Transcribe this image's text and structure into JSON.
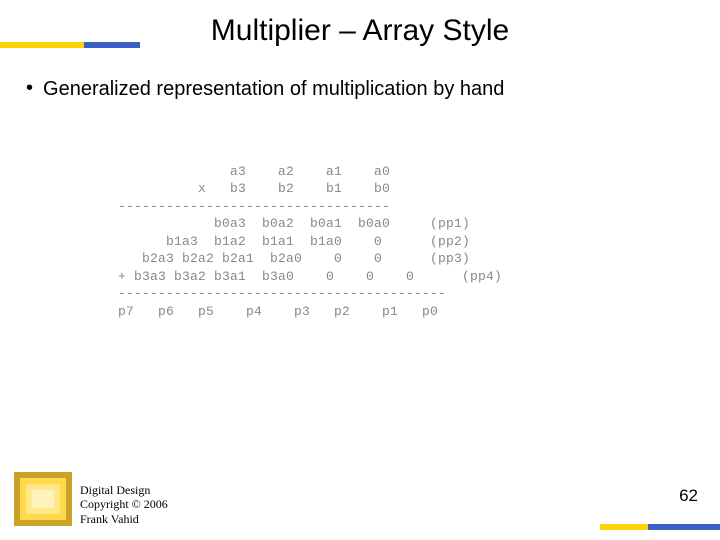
{
  "title": "Multiplier – Array Style",
  "bullet": "Generalized representation of multiplication by hand",
  "diagram": {
    "r1": "              a3    a2    a1    a0",
    "r2": "          x   b3    b2    b1    b0",
    "r3": "----------------------------------",
    "r4": "            b0a3  b0a2  b0a1  b0a0     (pp1)",
    "r5": "      b1a3  b1a2  b1a1  b1a0    0      (pp2)",
    "r6": "   b2a3 b2a2 b2a1  b2a0    0    0      (pp3)",
    "r7": "+ b3a3 b3a2 b3a1  b3a0    0    0    0      (pp4)",
    "r8": "-----------------------------------------",
    "r9": "p7   p6   p5    p4    p3   p2    p1   p0"
  },
  "footer": {
    "line1": "Digital Design",
    "line2": "Copyright © 2006",
    "line3": "Frank Vahid"
  },
  "page_number": "62",
  "colors": {
    "accent_yellow": "#ffd500",
    "accent_blue": "#3b5fc4"
  }
}
